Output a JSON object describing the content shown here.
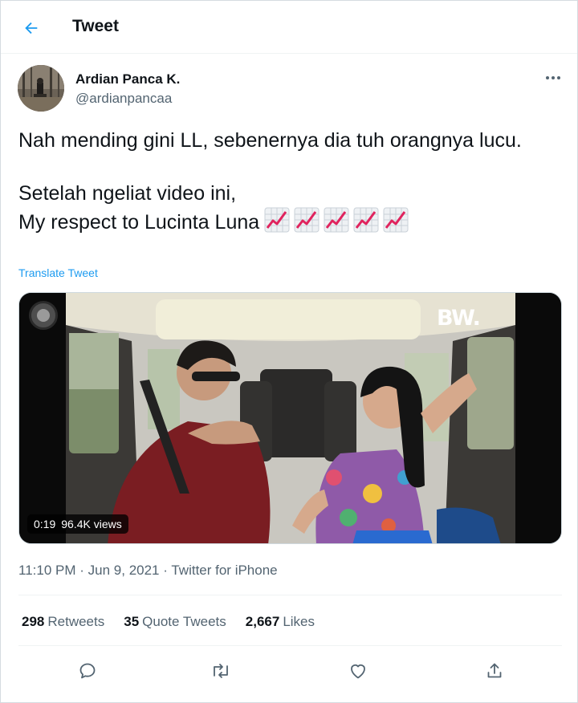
{
  "header": {
    "title": "Tweet",
    "back_icon": "arrow-left-icon"
  },
  "author": {
    "name": "Ardian Panca K.",
    "handle": "@ardianpancaa"
  },
  "tweet": {
    "line1": "Nah mending gini LL, sebenernya dia tuh orangnya lucu.",
    "line2": "Setelah ngeliat video ini,",
    "line3": "My respect to Lucinta Luna",
    "emoji": [
      "chart-increasing-icon",
      "chart-increasing-icon",
      "chart-increasing-icon",
      "chart-increasing-icon",
      "chart-increasing-icon"
    ],
    "translate_label": "Translate Tweet"
  },
  "media": {
    "watermark": "BW.",
    "duration": "0:19",
    "views": "96.4K views"
  },
  "meta": {
    "time": "11:10 PM",
    "sep1": "·",
    "date": "Jun 9, 2021",
    "sep2": "·",
    "source": "Twitter for iPhone"
  },
  "stats": [
    {
      "count": "298",
      "label": "Retweets"
    },
    {
      "count": "35",
      "label": "Quote Tweets"
    },
    {
      "count": "2,667",
      "label": "Likes"
    }
  ],
  "actions": [
    "reply-icon",
    "retweet-icon",
    "like-icon",
    "share-icon"
  ],
  "colors": {
    "accent": "#1d9bf0",
    "text": "#0f1419",
    "secondary": "#536471",
    "border": "#eff3f4"
  }
}
